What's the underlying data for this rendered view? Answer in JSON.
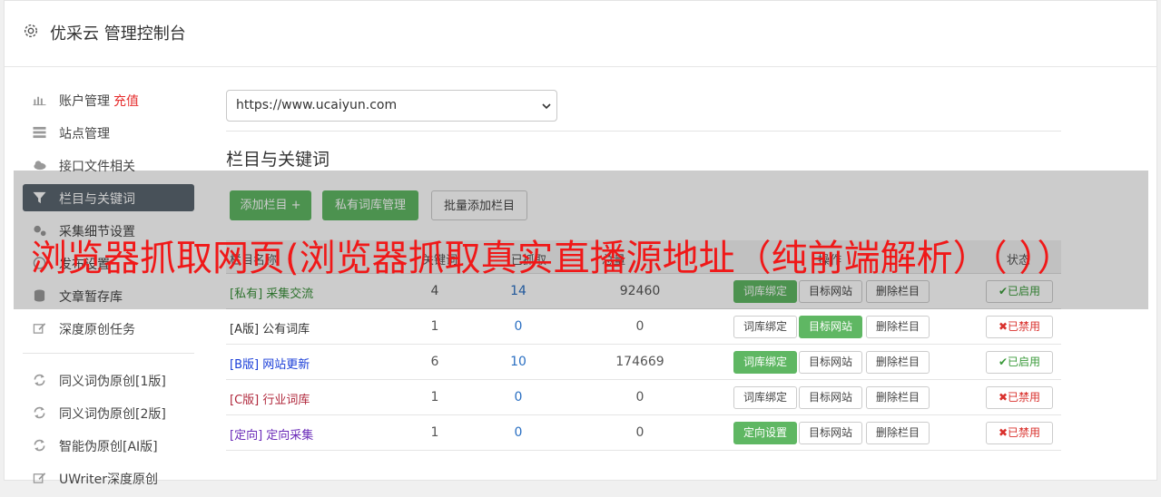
{
  "header": {
    "title": "优采云 管理控制台"
  },
  "sidebar": {
    "items": [
      {
        "label": "账户管理",
        "extra": "充值",
        "icon": "bar-chart-icon"
      },
      {
        "label": "站点管理",
        "icon": "server-icon"
      },
      {
        "label": "接口文件相关",
        "icon": "cloud-upload-icon"
      },
      {
        "label": "栏目与关键词",
        "icon": "filter-icon",
        "active": true
      },
      {
        "label": "采集细节设置",
        "icon": "gears-icon"
      },
      {
        "label": "发布设置",
        "icon": "globe-icon"
      },
      {
        "label": "文章暂存库",
        "icon": "database-icon"
      },
      {
        "label": "深度原创任务",
        "icon": "edit-icon"
      }
    ],
    "tools": [
      {
        "label": "同义词伪原创[1版]",
        "icon": "refresh-icon"
      },
      {
        "label": "同义词伪原创[2版]",
        "icon": "refresh-icon"
      },
      {
        "label": "智能伪原创[AI版]",
        "icon": "refresh-icon"
      },
      {
        "label": "UWriter深度原创",
        "icon": "edit-icon"
      }
    ]
  },
  "main": {
    "site_select": {
      "value": "https://www.ucaiyun.com"
    },
    "section_title": "栏目与关键词",
    "buttons": {
      "add_column": "添加栏目 +",
      "private_lib": "私有词库管理",
      "batch_add": "批量添加栏目"
    },
    "table": {
      "headers": [
        "栏目名称",
        "关键词",
        "已抓取",
        "总量",
        "操作",
        "状态"
      ],
      "rows": [
        {
          "name": "[私有] 采集交流",
          "color": "#3a8f3a",
          "c1": "4",
          "c2": "14",
          "c3": "92460",
          "b1": "词库绑定",
          "b1g": true,
          "b2": "目标网站",
          "b2g": false,
          "b3": "删除栏目",
          "status": "✔已启用",
          "on": true
        },
        {
          "name": "[A版] 公有词库",
          "color": "#333333",
          "c1": "1",
          "c2": "0",
          "c3": "0",
          "b1": "词库绑定",
          "b1g": false,
          "b2": "目标网站",
          "b2g": true,
          "b3": "删除栏目",
          "status": "✖已禁用",
          "on": false
        },
        {
          "name": "[B版] 网站更新",
          "color": "#1a3ed8",
          "c1": "6",
          "c2": "10",
          "c3": "174669",
          "b1": "词库绑定",
          "b1g": true,
          "b2": "目标网站",
          "b2g": false,
          "b3": "删除栏目",
          "status": "✔已启用",
          "on": true
        },
        {
          "name": "[C版] 行业词库",
          "color": "#b0283c",
          "c1": "1",
          "c2": "0",
          "c3": "0",
          "b1": "词库绑定",
          "b1g": false,
          "b2": "目标网站",
          "b2g": false,
          "b3": "删除栏目",
          "status": "✖已禁用",
          "on": false
        },
        {
          "name": "[定向] 定向采集",
          "color": "#6a2ab8",
          "c1": "1",
          "c2": "0",
          "c3": "0",
          "b1": "定向设置",
          "b1g": true,
          "b2": "目标网站",
          "b2g": false,
          "b3": "删除栏目",
          "status": "✖已禁用",
          "on": false
        }
      ]
    }
  },
  "banner": {
    "text": "浏览器抓取网页(浏览器抓取真实直播源地址（纯前端解析）（  ））"
  }
}
